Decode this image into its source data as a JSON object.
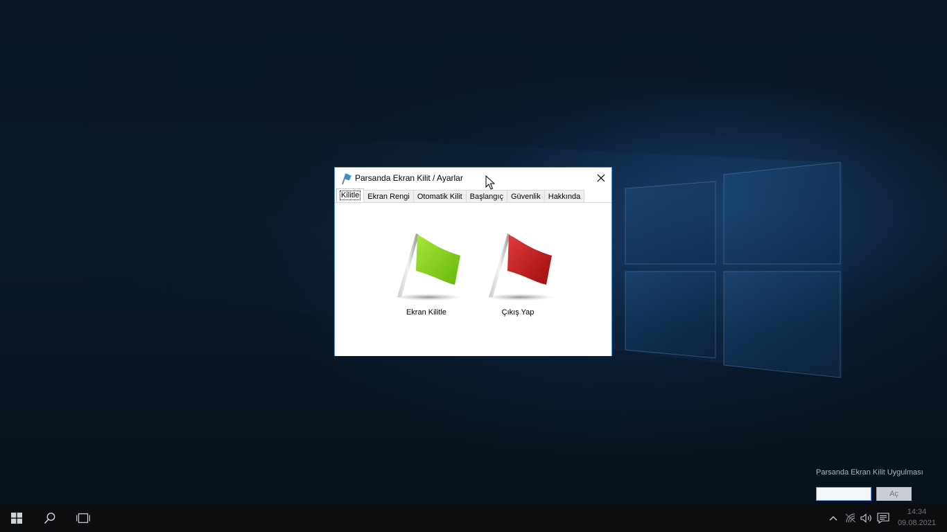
{
  "dialog": {
    "title": "Parsanda Ekran Kilit / Ayarlar",
    "tabs": [
      {
        "label": "Kilitle",
        "active": true
      },
      {
        "label": "Ekran Rengi",
        "active": false
      },
      {
        "label": "Otomatik Kilit",
        "active": false
      },
      {
        "label": "Başlangıç",
        "active": false
      },
      {
        "label": "Güvenlik",
        "active": false
      },
      {
        "label": "Hakkında",
        "active": false
      }
    ],
    "actions": {
      "lock_label": "Ekran Kilitle",
      "exit_label": "Çıkış Yap"
    }
  },
  "widget": {
    "title": "Parsanda Ekran Kilit Uygulması",
    "input_value": "",
    "open_label": "Aç"
  },
  "taskbar": {
    "time": "14:34",
    "date": "09.08.2021"
  },
  "colors": {
    "green_flag": "#8fd22a",
    "red_flag": "#c81a1a",
    "dialog_border": "#4a90d9"
  }
}
